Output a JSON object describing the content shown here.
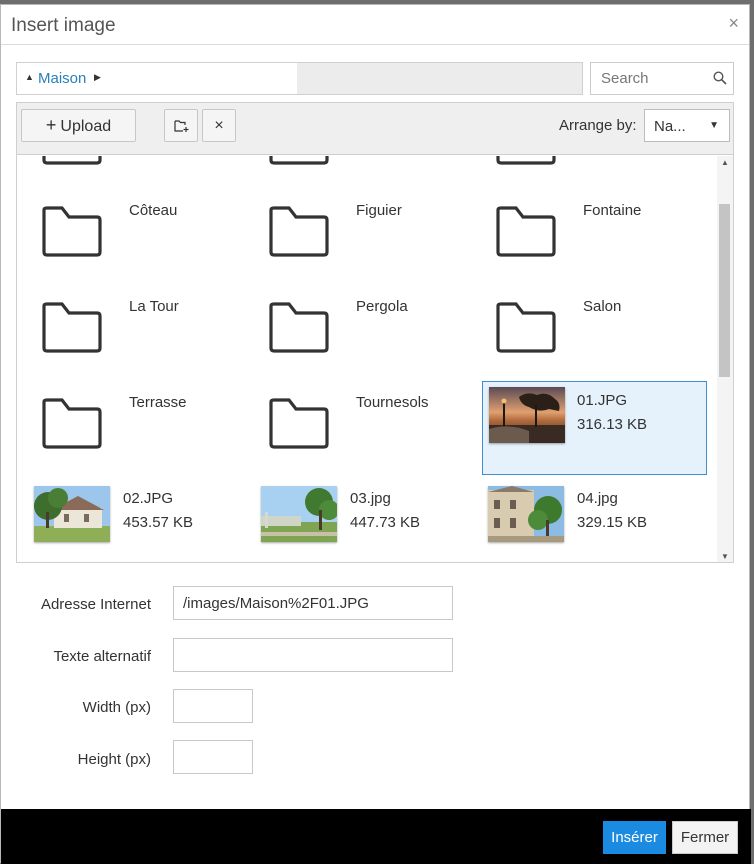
{
  "dialog": {
    "title": "Insert image",
    "close_glyph": "×"
  },
  "breadcrumb": {
    "up_glyph": "▲",
    "current": "Maison",
    "arrow_glyph": "▶"
  },
  "search": {
    "placeholder": "Search",
    "icon": "search-icon"
  },
  "toolbar": {
    "upload_label": "Upload",
    "upload_glyph": "+",
    "new_folder_icon": "new-folder-icon",
    "delete_glyph": "×",
    "arrange_label": "Arrange by:",
    "arrange_value": "Na...",
    "arrange_caret": "▼"
  },
  "folders": [
    {
      "name": "Côteau"
    },
    {
      "name": "Figuier"
    },
    {
      "name": "Fontaine"
    },
    {
      "name": "La Tour"
    },
    {
      "name": "Pergola"
    },
    {
      "name": "Salon"
    },
    {
      "name": "Terrasse"
    },
    {
      "name": "Tournesols"
    }
  ],
  "files": [
    {
      "name": "01.JPG",
      "size": "316.13 KB",
      "selected": true
    },
    {
      "name": "02.JPG",
      "size": "453.57 KB",
      "selected": false
    },
    {
      "name": "03.jpg",
      "size": "447.73 KB",
      "selected": false
    },
    {
      "name": "04.jpg",
      "size": "329.15 KB",
      "selected": false
    }
  ],
  "scrollbar": {
    "up_glyph": "▲",
    "down_glyph": "▼"
  },
  "form": {
    "url_label": "Adresse Internet",
    "url_value": "/images/Maison%2F01.JPG",
    "alt_label": "Texte alternatif",
    "alt_value": "",
    "width_label": "Width (px)",
    "width_value": "",
    "height_label": "Height (px)",
    "height_value": ""
  },
  "footer": {
    "insert_label": "Insérer",
    "close_label": "Fermer"
  },
  "colors": {
    "accent": "#1a8be0",
    "link": "#2a7fb8",
    "selected_bg": "#e5f1fb",
    "selected_border": "#3e8ed0"
  }
}
